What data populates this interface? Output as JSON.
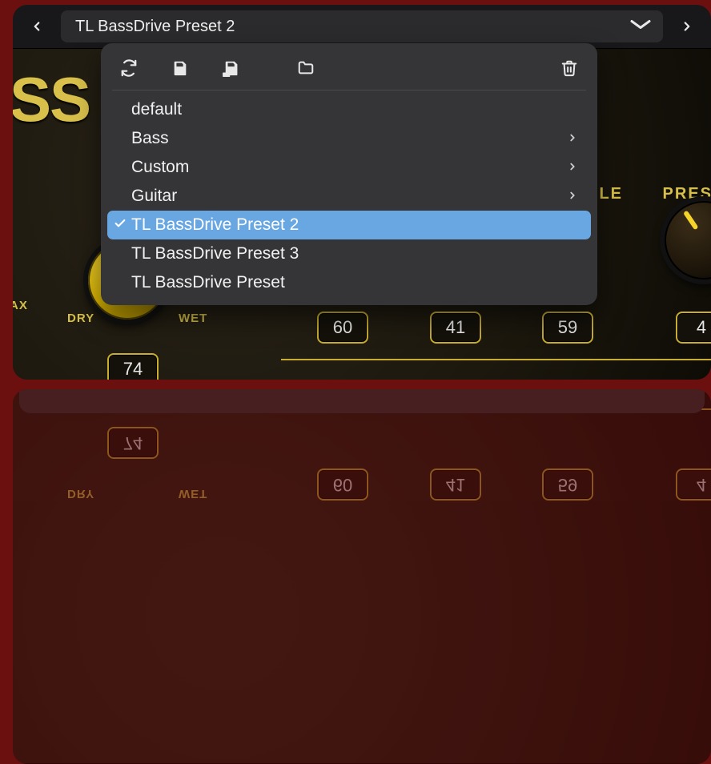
{
  "header": {
    "preset_name": "TL BassDrive Preset 2"
  },
  "plugin": {
    "brand_fragment": "SS D",
    "labels": {
      "dry": "DRY",
      "wet": "WET",
      "ax": "AX",
      "le": "LE",
      "pres": "PRES"
    },
    "values": {
      "mix": "74",
      "p1": "60",
      "p2": "41",
      "p3": "59",
      "p4": "4"
    }
  },
  "dropdown": {
    "items": [
      {
        "label": "default",
        "submenu": false,
        "selected": false
      },
      {
        "label": "Bass",
        "submenu": true,
        "selected": false
      },
      {
        "label": "Custom",
        "submenu": true,
        "selected": false
      },
      {
        "label": "Guitar",
        "submenu": true,
        "selected": false
      },
      {
        "label": "TL BassDrive Preset 2",
        "submenu": false,
        "selected": true
      },
      {
        "label": "TL BassDrive Preset 3",
        "submenu": false,
        "selected": false
      },
      {
        "label": "TL BassDrive Preset",
        "submenu": false,
        "selected": false
      }
    ]
  }
}
